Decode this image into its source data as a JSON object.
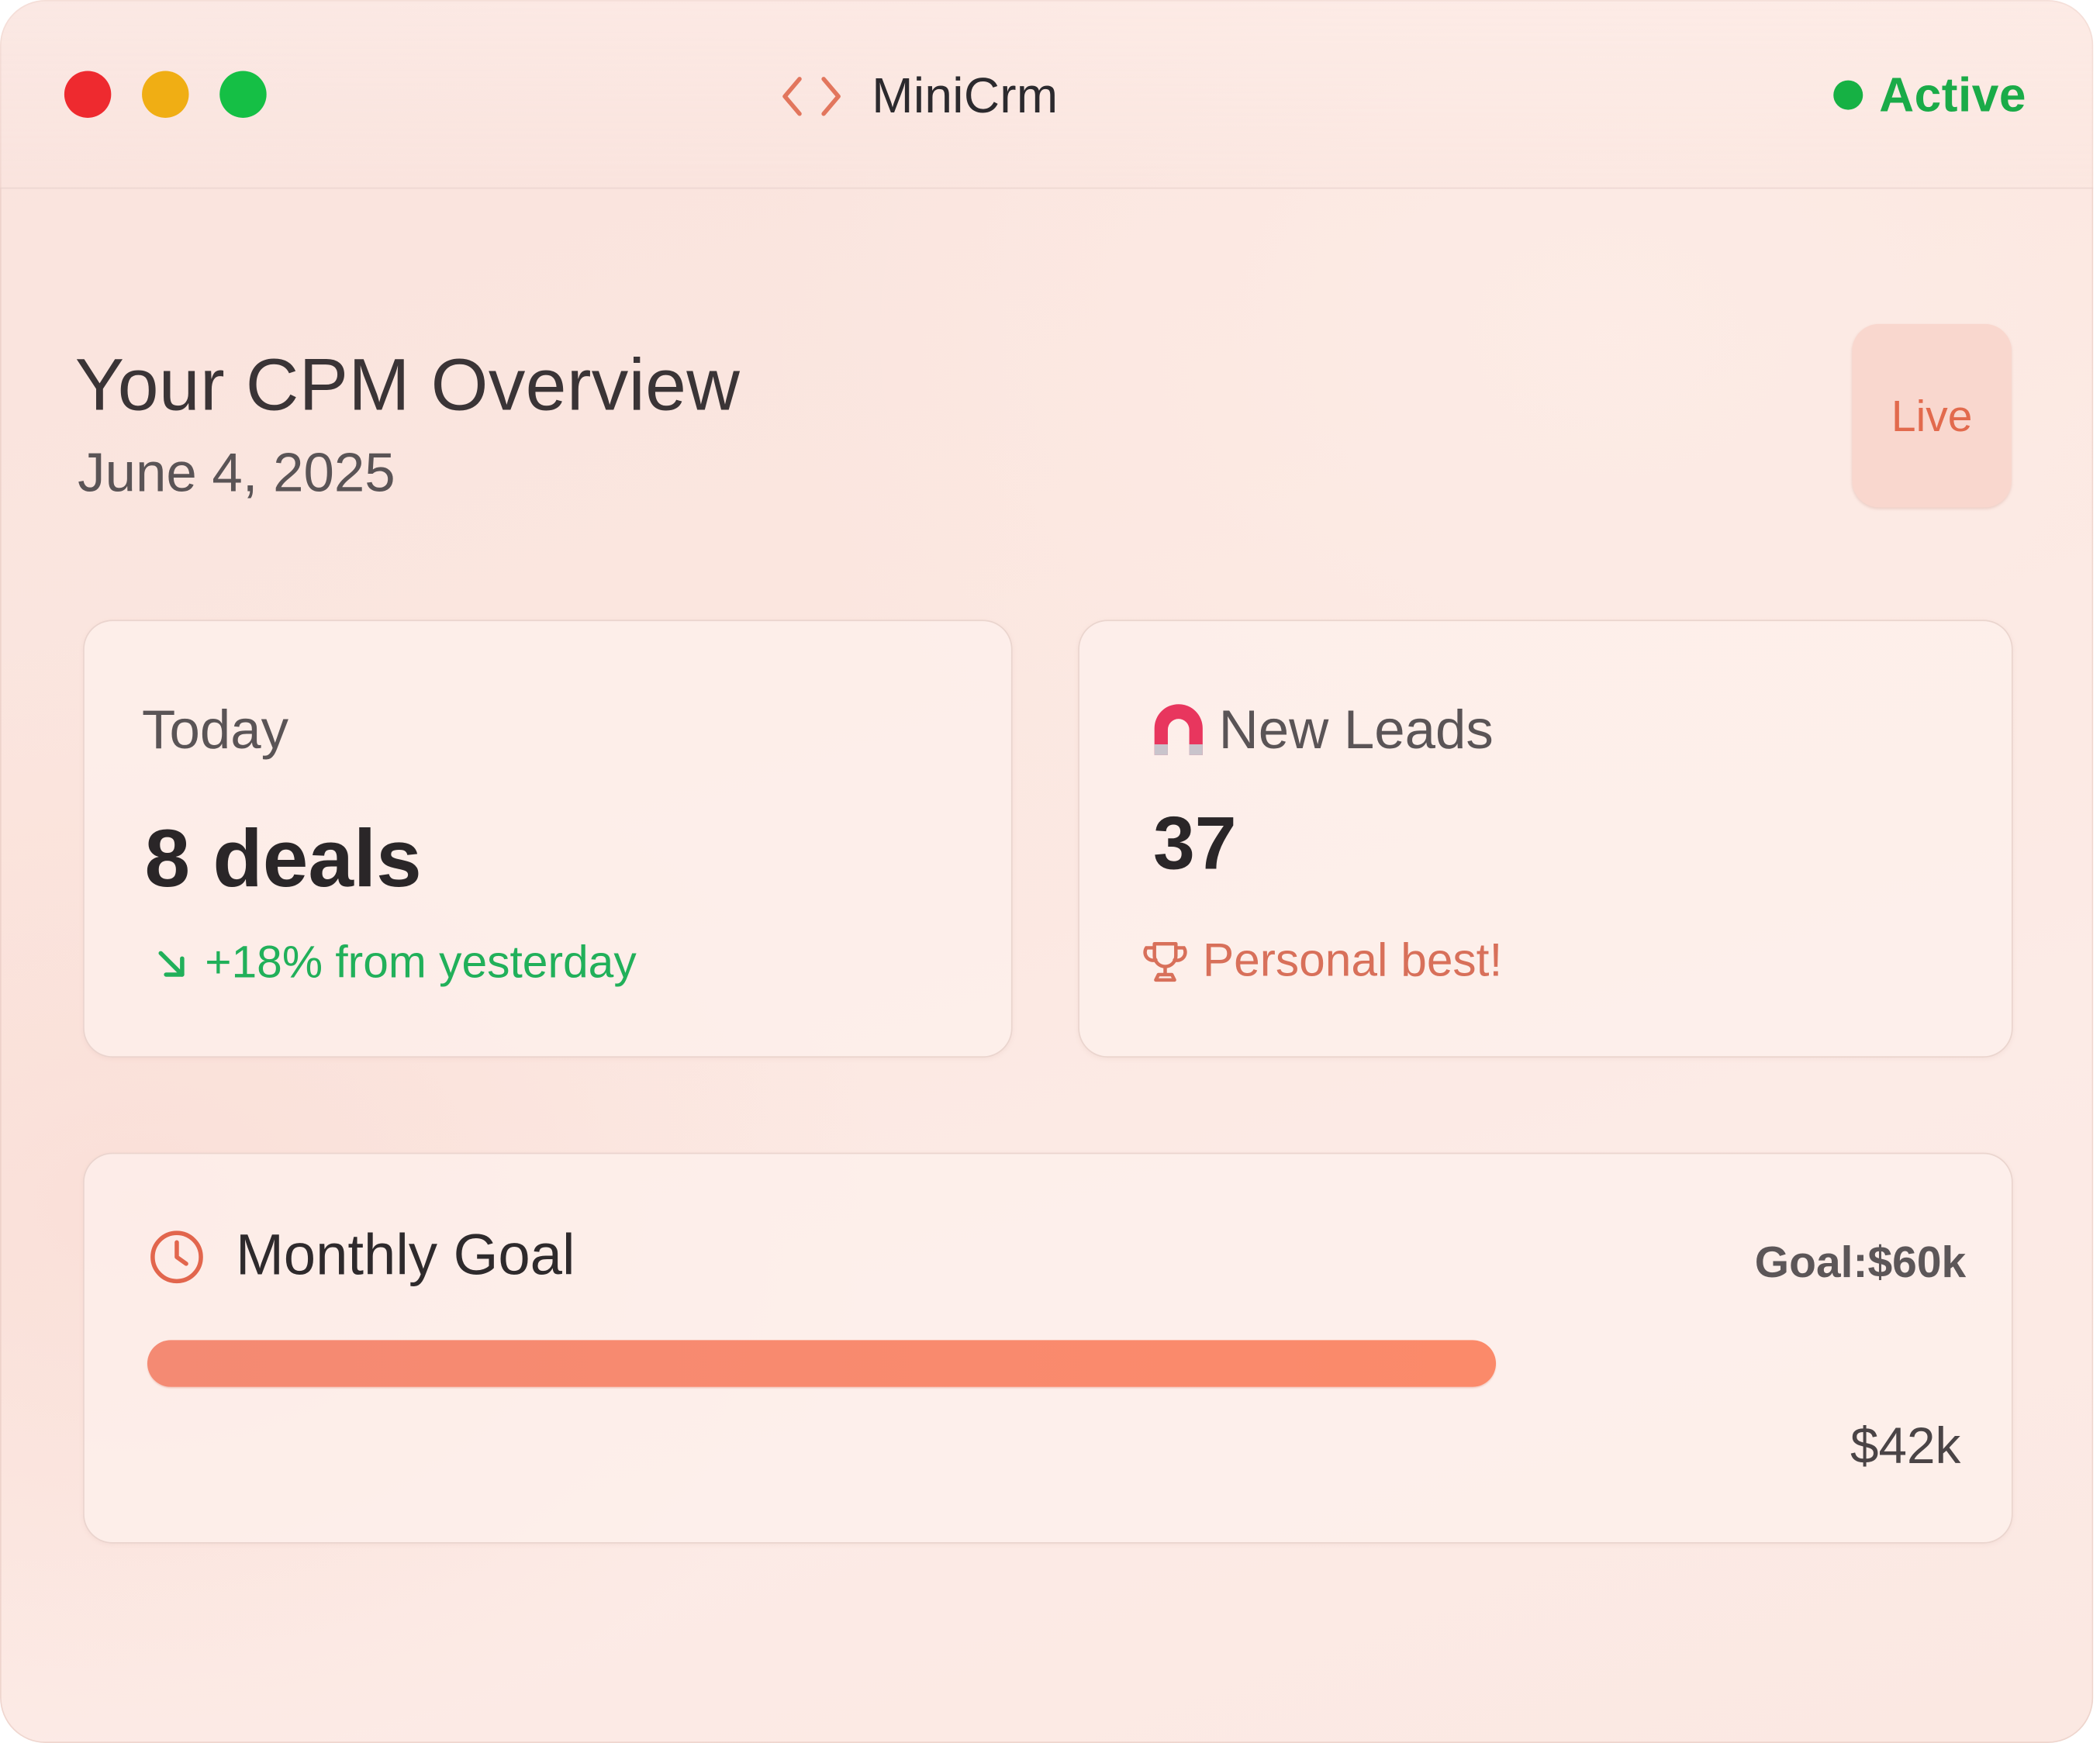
{
  "window": {
    "controls": [
      "close",
      "minimize",
      "maximize"
    ],
    "app_icon": "code-brackets-icon",
    "app_name": "MiniCrm",
    "status_label": "Active",
    "status_color": "#16b144"
  },
  "header": {
    "title": "Your CPM Overview",
    "date": "June 4, 2025",
    "live_badge": "Live"
  },
  "cards": {
    "today": {
      "label": "Today",
      "value": "8 deals",
      "trend_icon": "arrow-down-right-icon",
      "trend_text": "+18% from yesterday",
      "trend_color": "#21b05a"
    },
    "leads": {
      "icon": "magnet-icon",
      "label": "New Leads",
      "value": "37",
      "badge_icon": "trophy-icon",
      "badge_text": "Personal best!"
    }
  },
  "goal": {
    "icon": "clock-icon",
    "title": "Monthly Goal",
    "target_label": "Goal:$60k",
    "current_label": "$42k",
    "progress": 0.743,
    "bar_color": "#f98a6e"
  }
}
